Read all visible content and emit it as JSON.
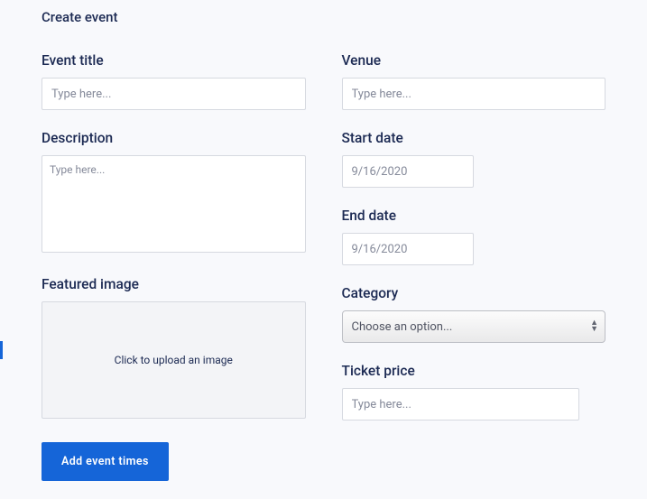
{
  "page": {
    "title": "Create event"
  },
  "left": {
    "event_title": {
      "label": "Event title",
      "placeholder": "Type here..."
    },
    "description": {
      "label": "Description",
      "placeholder": "Type here..."
    },
    "featured_image": {
      "label": "Featured image",
      "upload_text": "Click to upload an image"
    },
    "button": {
      "label": "Add event times"
    }
  },
  "right": {
    "venue": {
      "label": "Venue",
      "placeholder": "Type here..."
    },
    "start_date": {
      "label": "Start date",
      "value": "9/16/2020"
    },
    "end_date": {
      "label": "End date",
      "value": "9/16/2020"
    },
    "category": {
      "label": "Category",
      "selected": "Choose an option..."
    },
    "ticket_price": {
      "label": "Ticket price",
      "placeholder": "Type here..."
    }
  }
}
